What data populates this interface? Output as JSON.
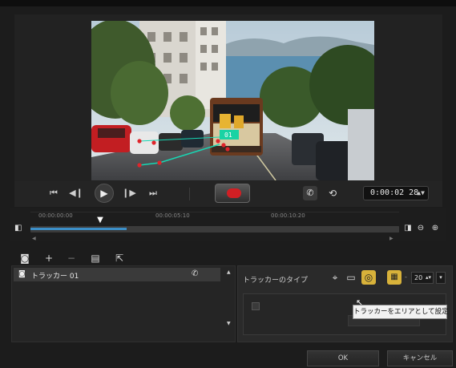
{
  "transport": {
    "timecode": "0:00:02 28",
    "timecode_spin": "▲▼",
    "icons": [
      "skip-to-start-icon",
      "step-back-icon",
      "play-icon",
      "step-forward-icon",
      "skip-to-end-icon",
      "record-icon",
      "phone-icon",
      "history-icon"
    ]
  },
  "timeline": {
    "ticks": [
      "00:00:00:00",
      "00:00:05:10",
      "00:00:10:20"
    ],
    "progress": 0.26
  },
  "tracker_list": {
    "items": [
      {
        "label": "トラッカー 01"
      }
    ]
  },
  "properties": {
    "type_label": "トラッカーのタイプ",
    "size_value": "20",
    "tooltip": "トラッカーをエリアとして設定"
  },
  "buttons": {
    "ok": "OK",
    "cancel": "キャンセル"
  },
  "overlay": {
    "tracker_label": "01"
  },
  "colors": {
    "accent": "#3c8fc8",
    "record": "#d11f24",
    "selected_tool": "#d8b23a",
    "tracker_box": "#19d3a4"
  }
}
